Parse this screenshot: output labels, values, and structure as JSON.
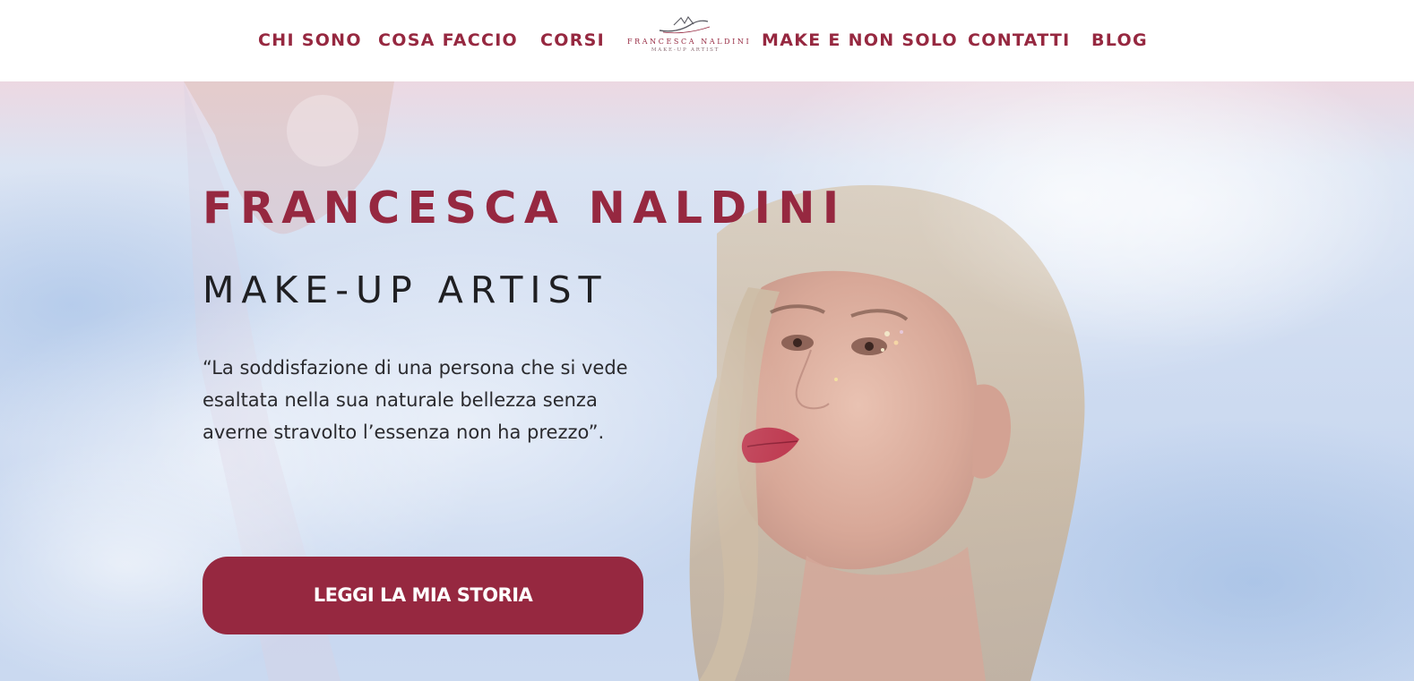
{
  "colors": {
    "accent": "#962840",
    "text_dark": "#1f1f22",
    "header_bg": "#ffffff",
    "hero_bg": "#cfdcf1"
  },
  "nav": {
    "left_items": [
      {
        "label": "CHI SONO"
      },
      {
        "label": "COSA FACCIO"
      },
      {
        "label": "CORSI"
      }
    ],
    "right_items": [
      {
        "label": "MAKE E NON SOLO"
      },
      {
        "label": "CONTATTI"
      },
      {
        "label": "BLOG"
      }
    ],
    "logo": {
      "name": "FRANCESCA NALDINI",
      "tagline": "MAKE-UP ARTIST",
      "icon": "brush-stroke-logo-icon"
    }
  },
  "hero": {
    "title": "FRANCESCA NALDINI",
    "subtitle": "MAKE-UP ARTIST",
    "quote_lines": [
      "“La soddisfazione di una persona che si vede",
      "esaltata nella sua naturale bellezza senza",
      "averne stravolto l’essenza non ha prezzo”."
    ],
    "cta_label": "LEGGI LA MIA STORIA",
    "background_image": "portrait-photo"
  }
}
